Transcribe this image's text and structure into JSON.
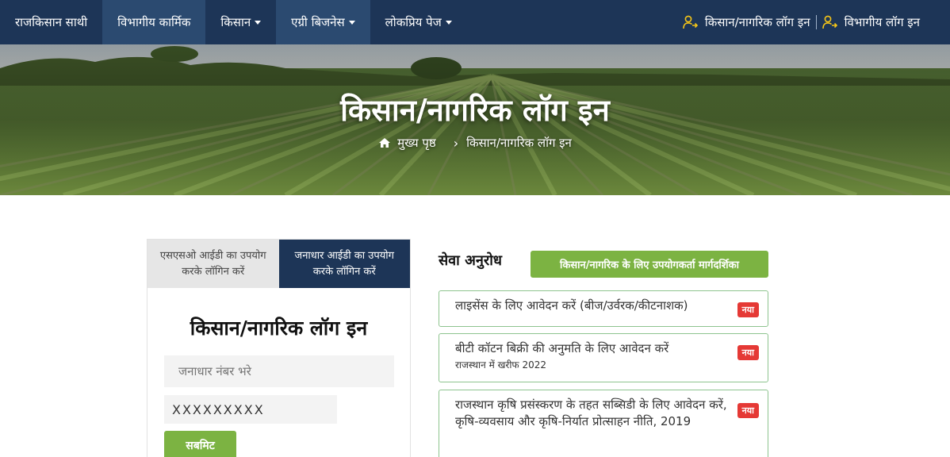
{
  "nav": {
    "items": [
      {
        "label": "राजकिसान साथी",
        "dropdown": false
      },
      {
        "label": "विभागीय कार्मिक",
        "dropdown": false
      },
      {
        "label": "किसान",
        "dropdown": true
      },
      {
        "label": "एग्री बिजनेस",
        "dropdown": true
      },
      {
        "label": "लोकप्रिय पेज",
        "dropdown": true
      }
    ],
    "farmer_login": "किसान/नागरिक लॉग इन",
    "dept_login": "विभागीय लॉग इन",
    "icon_color": "#f5c518",
    "bg_color": "#1d3557"
  },
  "hero": {
    "title": "किसान/नागरिक लॉग इन",
    "breadcrumb_home": "मुख्य पृष्ठ",
    "breadcrumb_current": "किसान/नागरिक लॉग इन"
  },
  "login": {
    "tab_sso": "एसएसओ आईडी का उपयोग करके लॉगिन करें",
    "tab_jan": "जनाधार आईडी का उपयोग करके लॉगिन करें",
    "title": "किसान/नागरिक लॉग इन",
    "jan_placeholder": "जनाधार नंबर भरे",
    "captcha_value": "XXXXXXXXX",
    "submit": "सबमिट"
  },
  "services": {
    "heading": "सेवा अनुरोध",
    "guide": "किसान/नागरिक के लिए उपयोगकर्ता मार्गदर्शिका",
    "new_badge": "नया",
    "item1_title": "लाइसेंस के लिए आवेदन करें (बीज/उर्वरक/कीटनाशक)",
    "item2_title": "बीटी कॉटन बिक्री की अनुमति के लिए आवेदन करें",
    "item2_sub": "राजस्थान में खरीफ 2022",
    "item3_title": "राजस्थान कृषि प्रसंस्करण के तहत सब्सिडी के लिए आवेदन करें,",
    "item3_line2": "कृषि-व्यवसाय और कृषि-निर्यात प्रोत्साहन नीति, 2019",
    "accent_green": "#7cb342",
    "badge_red": "#e53935"
  }
}
